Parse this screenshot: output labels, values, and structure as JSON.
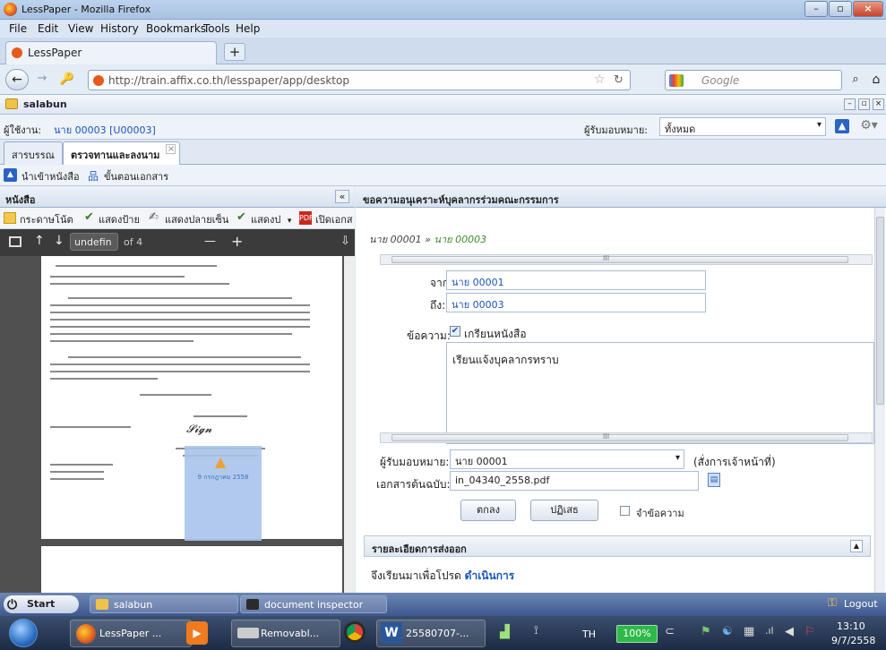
{
  "window": {
    "title": "LessPaper - Mozilla Firefox"
  },
  "menu": [
    "File",
    "Edit",
    "View",
    "History",
    "Bookmarks",
    "Tools",
    "Help"
  ],
  "browser_tab": {
    "label": "LessPaper",
    "new_tab": "+"
  },
  "nav": {
    "url": "http://train.affix.co.th/lesspaper/app/desktop",
    "search_placeholder": "Google"
  },
  "app": {
    "workspace": "salabun",
    "user_label": "ผู้ใช้งาน:",
    "user_value": "นาย 00003 [U00003]",
    "assignee_filter_label": "ผู้รับมอบหมาย:",
    "assignee_filter_value": "ทั้งหมด",
    "tabs": [
      "สารบรรณ",
      "ตรวจทานและลงนาม"
    ],
    "tab_close": "×",
    "toolbar": [
      "นำเข้าหนังสือ",
      "ขั้นตอนเอกสาร"
    ]
  },
  "left_panel": {
    "title": "หนังสือ",
    "collapse": "«",
    "tools": [
      "กระดาษโน้ต",
      "แสดงป้าย",
      "แสดงปลายเซ็น",
      "แสดงป",
      "เปิดเอกส"
    ],
    "pdf": {
      "page_input": "undefin",
      "page_total": "of 4",
      "zoom_out": "—",
      "zoom_in": "+"
    },
    "note_text": "9 กรกฎาคม 2558"
  },
  "right_panel": {
    "title": "ขอความอนุเคราะห์บุคลากรร่วมคณะกรรมการ",
    "breadcrumb_from": "นาย 00001",
    "breadcrumb_sep": "»",
    "breadcrumb_to": "นาย 00003",
    "from_label": "จาก:",
    "from_value": "นาย 00001",
    "to_label": "ถึง:",
    "to_value": "นาย 00003",
    "message_label": "ข้อความ:",
    "message_checkbox": "เกรียนหนังสือ",
    "message_body": "เรียนแจ้งบุคลากรทราบ",
    "assignee_label": "ผู้รับมอบหมาย:",
    "assignee_value": "นาย 00001",
    "assignee_note": "(สั่งการเจ้าหน้าที่)",
    "attachment_label": "เอกสารต้นฉบับ:",
    "attachment_value": "in_04340_2558.pdf",
    "ok_button": "ตกลง",
    "reject_button": "ปฏิเสธ",
    "remember_label": "จำข้อความ",
    "details_header": "รายละเอียดการส่งออก",
    "details_text_prefix": "จึงเรียนมาเพื่อโปรด",
    "details_text_action": "ดำเนินการ",
    "scroll_mark": "III"
  },
  "taskbar": {
    "start": "Start",
    "items": [
      "salabun",
      "document inspector"
    ],
    "logout": "Logout",
    "tasks": [
      "LessPaper ...",
      "Removabl...",
      "25580707-..."
    ],
    "lang": "TH",
    "battery": "100%",
    "time": "13:10",
    "date": "9/7/2558"
  },
  "colors": {
    "accent": "#2a63c4",
    "link": "#1a56b8",
    "chrome": "#dfe8f3"
  }
}
